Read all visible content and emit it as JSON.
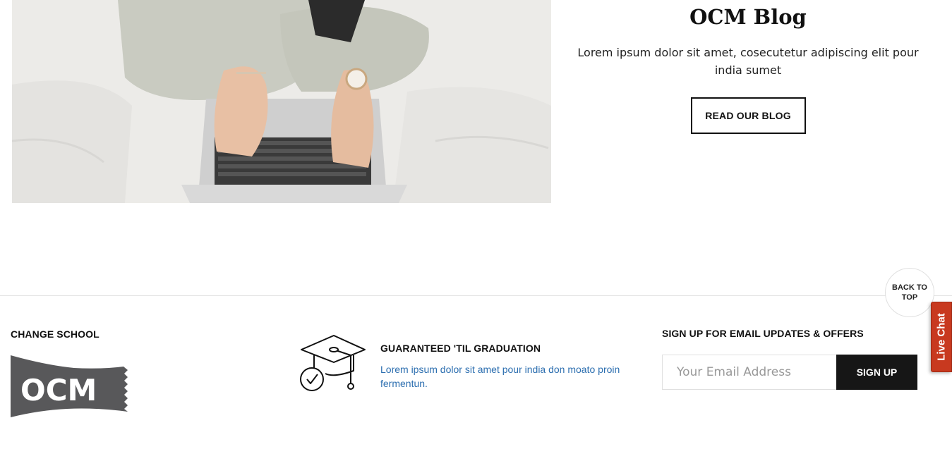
{
  "blog": {
    "title": "OCM Blog",
    "description": "Lorem ipsum dolor sit amet, cosecutetur adipiscing elit pour india sumet",
    "button_label": "READ OUR BLOG"
  },
  "back_to_top": {
    "label": "BACK TO TOP"
  },
  "live_chat": {
    "label": "Live Chat",
    "color": "#c8391f"
  },
  "footer": {
    "change_school": {
      "heading": "CHANGE SCHOOL",
      "logo_text": "OCM",
      "logo_color": "#58585a"
    },
    "guarantee": {
      "icon": "graduation-cap-check-icon",
      "heading": "GUARANTEED 'TIL GRADUATION",
      "description": "Lorem ipsum dolor sit amet pour india don moato proin fermentun.",
      "link_color": "#2d6fb0"
    },
    "signup": {
      "heading": "SIGN UP FOR EMAIL UPDATES & OFFERS",
      "email_placeholder": "Your Email Address",
      "email_value": "",
      "button_label": "SIGN UP"
    }
  }
}
